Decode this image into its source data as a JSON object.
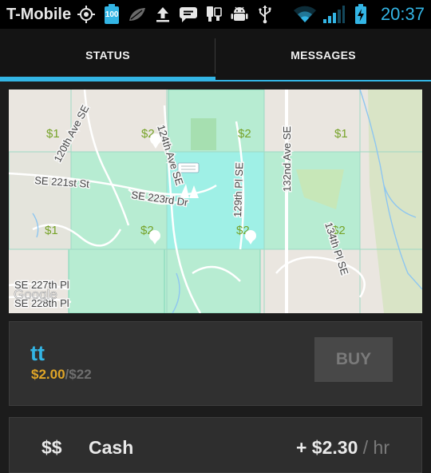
{
  "status_bar": {
    "carrier": "T-Mobile",
    "battery_badge": "100",
    "clock": "20:37",
    "icons": [
      "gps-icon",
      "battery-widget-icon",
      "leaf-icon",
      "upload-icon",
      "sms-icon",
      "usb-icon",
      "android-icon",
      "usb-debug-icon",
      "wifi-icon",
      "signal-icon",
      "battery-charging-icon"
    ]
  },
  "tabs": [
    {
      "label": "STATUS",
      "selected": true
    },
    {
      "label": "MESSAGES",
      "selected": false
    }
  ],
  "map": {
    "prices": [
      "$1",
      "$2",
      "$2",
      "$1",
      "$1",
      "$2",
      "$2",
      "$2"
    ],
    "streets": [
      "120th Ave SE",
      "124th Ave SE",
      "SE 221st St",
      "SE 223rd Dr",
      "129th Pl SE",
      "132nd Ave SE",
      "134th Pl SE",
      "SE 227th Pl",
      "SE 228th Pl"
    ],
    "attribution": "Google",
    "colors": {
      "base": "#eae6e0",
      "zone_green": "#b7ecd2",
      "zone_cyan": "#9ff0e6",
      "water": "#8ec6f0"
    }
  },
  "card": {
    "name": "tt",
    "current_price": "$2.00",
    "separator": "/",
    "max_price": "$22",
    "buy_label": "BUY"
  },
  "payment": {
    "symbol": "$$",
    "method": "Cash",
    "rate": "+ $2.30",
    "unit": "/ hr"
  },
  "colors": {
    "accent": "#33b5e5",
    "price": "#e0a527",
    "map_price": "#77a32a"
  }
}
